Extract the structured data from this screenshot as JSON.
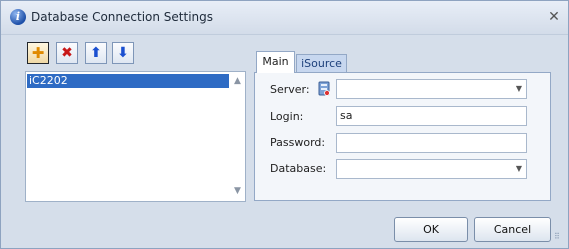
{
  "window": {
    "title": "Database Connection Settings",
    "close_glyph": "✕"
  },
  "toolbar": {
    "add_glyph": "✚",
    "delete_glyph": "✖",
    "up_glyph": "⬆",
    "down_glyph": "⬇"
  },
  "connections": {
    "items": [
      "iC2202"
    ],
    "selected_index": 0
  },
  "tabs": [
    {
      "label": "Main",
      "active": true
    },
    {
      "label": "iSource",
      "active": false
    }
  ],
  "form": {
    "server_label": "Server:",
    "server_value": "",
    "login_label": "Login:",
    "login_value": "sa",
    "password_label": "Password:",
    "password_value": "",
    "database_label": "Database:",
    "database_value": ""
  },
  "buttons": {
    "ok": "OK",
    "cancel": "Cancel"
  },
  "colors": {
    "selection": "#2e6bc4",
    "add_icon": "#e08a00",
    "delete_icon": "#c81818",
    "arrow_icon": "#1a4fd0"
  }
}
